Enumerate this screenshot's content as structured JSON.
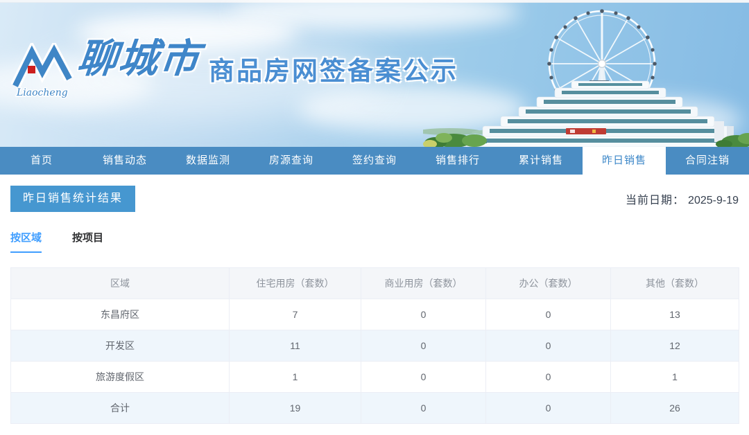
{
  "banner": {
    "logo_text": "聊城市",
    "logo_latin": "Liaocheng",
    "title": "商品房网签备案公示"
  },
  "nav": {
    "items": [
      {
        "key": "home",
        "label": "首页",
        "active": false
      },
      {
        "key": "sales-dynamics",
        "label": "销售动态",
        "active": false
      },
      {
        "key": "data-monitoring",
        "label": "数据监测",
        "active": false
      },
      {
        "key": "housing-query",
        "label": "房源查询",
        "active": false
      },
      {
        "key": "signing-query",
        "label": "签约查询",
        "active": false
      },
      {
        "key": "sales-ranking",
        "label": "销售排行",
        "active": false
      },
      {
        "key": "cumulative-sales",
        "label": "累计销售",
        "active": false
      },
      {
        "key": "yesterday-sales",
        "label": "昨日销售",
        "active": true
      },
      {
        "key": "contract-cancellation",
        "label": "合同注销",
        "active": false
      }
    ]
  },
  "section": {
    "title": "昨日销售统计结果",
    "date_label": "当前日期：",
    "date_value": "2025-9-19"
  },
  "tabs": [
    {
      "key": "by-region",
      "label": "按区域",
      "active": true
    },
    {
      "key": "by-project",
      "label": "按项目",
      "active": false
    }
  ],
  "table": {
    "headers": [
      "区域",
      "住宅用房（套数）",
      "商业用房（套数）",
      "办公（套数）",
      "其他（套数）"
    ],
    "rows": [
      [
        "东昌府区",
        "7",
        "0",
        "0",
        "13"
      ],
      [
        "开发区",
        "11",
        "0",
        "0",
        "12"
      ],
      [
        "旅游度假区",
        "1",
        "0",
        "0",
        "1"
      ],
      [
        "合计",
        "19",
        "0",
        "0",
        "26"
      ]
    ]
  },
  "colors": {
    "nav_bar": "#4a8cc2",
    "nav_active_text": "#3c87c8",
    "title_box": "#4697d0",
    "tab_active": "#409eff",
    "stripe_row_bg": "#eff6fc",
    "header_row_bg": "#f4f6f9",
    "table_border": "#ebeef5",
    "banner_text": "#4a8ed2"
  }
}
